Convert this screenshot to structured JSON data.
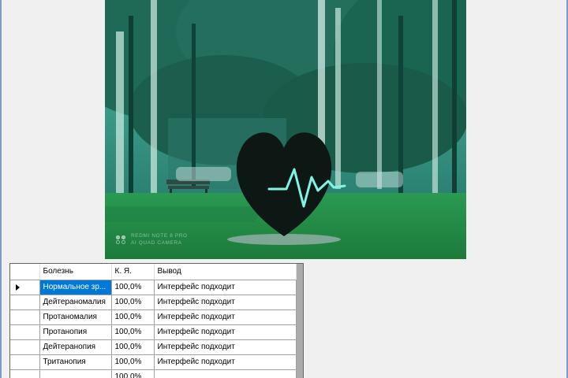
{
  "photo": {
    "watermark_line1": "REDMI NOTE 8 PRO",
    "watermark_line2": "AI QUAD CAMERA"
  },
  "grid": {
    "columns": [
      "Болезнь",
      "К. Я.",
      "Вывод"
    ],
    "rows": [
      [
        "Нормальное зр...",
        "100,0%",
        "Интерфейс подходит"
      ],
      [
        "Дейтераномалия",
        "100,0%",
        "Интерфейс подходит"
      ],
      [
        "Протаномалия",
        "100,0%",
        "Интерфейс подходит"
      ],
      [
        "Протанопия",
        "100,0%",
        "Интерфейс подходит"
      ],
      [
        "Дейтеранопия",
        "100,0%",
        "Интерфейс подходит"
      ],
      [
        "Тританопия",
        "100,0%",
        "Интерфейс подходит"
      ],
      [
        "",
        "100,0%",
        ""
      ]
    ],
    "current_row_icon": "row-pointer-icon",
    "selection_color": "#0078d7"
  }
}
